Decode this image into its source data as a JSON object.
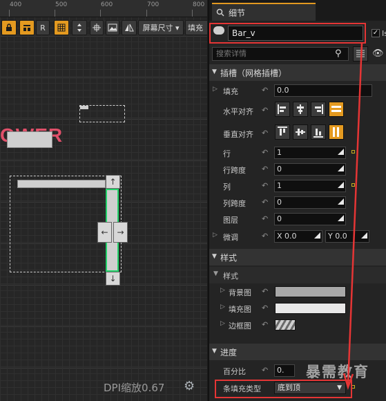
{
  "ruler": {
    "ticks": [
      "400",
      "500",
      "600",
      "700",
      "800"
    ]
  },
  "toolbar": {
    "r_label": "R",
    "screen_size_label": "屏幕尺寸 ▾",
    "fill_label": "填充"
  },
  "canvas": {
    "power_text": "OWER",
    "dpi_label": "DPI缩放0.67"
  },
  "panel": {
    "tab_title": "细节",
    "name_value": "Bar_v",
    "checkbox_label": "Is",
    "search_placeholder": "搜索详情",
    "slot_section": "插槽（网格插槽）",
    "padding_label": "填充",
    "padding_value": "0.0",
    "h_align_label": "水平对齐",
    "v_align_label": "垂直对齐",
    "row_label": "行",
    "row_value": "1",
    "row_span_label": "行跨度",
    "row_span_value": "0",
    "column_label": "列",
    "column_value": "1",
    "column_span_label": "列跨度",
    "column_span_value": "0",
    "layer_label": "图层",
    "layer_value": "0",
    "nudge_label": "微调",
    "nudge_x_label": "X",
    "nudge_x_value": "0.0",
    "nudge_y_label": "Y",
    "nudge_y_value": "0.0",
    "style_section": "样式",
    "style_sub_label": "样式",
    "background_image_label": "背景图",
    "fill_image_label": "填充图",
    "border_image_label": "边框图",
    "progress_section": "进度",
    "percent_label": "百分比",
    "percent_value": "0.",
    "bar_fill_type_label": "条填充类型",
    "bar_fill_type_value": "底到顶",
    "watermark": "暴需教育"
  },
  "colors": {
    "accent": "#e49a20",
    "highlight": "#e53535",
    "progress_fill": "#22d36a"
  }
}
